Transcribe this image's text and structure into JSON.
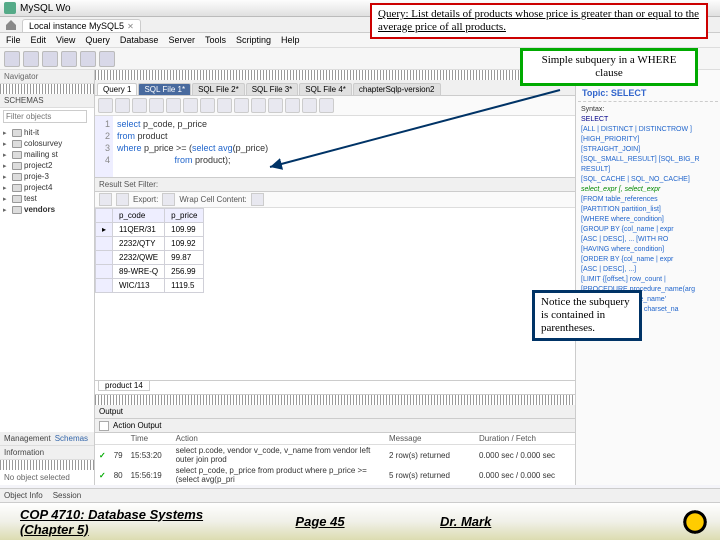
{
  "window": {
    "title": "MySQL Wo"
  },
  "conn_tab": {
    "label": "Local instance MySQL5"
  },
  "menubar": [
    "File",
    "Edit",
    "View",
    "Query",
    "Database",
    "Server",
    "Tools",
    "Scripting",
    "Help"
  ],
  "nav": {
    "header": "Navigator",
    "schemas_label": "SCHEMAS",
    "filter_placeholder": "Filter objects",
    "items": [
      {
        "label": "hit-it",
        "bold": false
      },
      {
        "label": "colosurvey",
        "bold": false
      },
      {
        "label": "mailing st",
        "bold": false
      },
      {
        "label": "project2",
        "bold": false
      },
      {
        "label": "proje-3",
        "bold": false
      },
      {
        "label": "project4",
        "bold": false
      },
      {
        "label": "test",
        "bold": false
      },
      {
        "label": "vendors",
        "bold": true
      }
    ],
    "mgmt_label": "Management",
    "mgmt_tab": "Schemas",
    "info_label": "Information",
    "info_text": "No object selected"
  },
  "query_tabs": [
    {
      "label": "Query 1",
      "kind": "sel"
    },
    {
      "label": "SQL File 1*",
      "kind": "active"
    },
    {
      "label": "SQL File 2*",
      "kind": "plain"
    },
    {
      "label": "SQL File 3*",
      "kind": "plain"
    },
    {
      "label": "SQL File 4*",
      "kind": "plain"
    },
    {
      "label": "chapterSqlp-version2",
      "kind": "plain"
    }
  ],
  "editor": {
    "lines": [
      "1",
      "2",
      "3",
      "4"
    ],
    "code": {
      "l1": {
        "kw": "select",
        "rest": " p_code, p_price"
      },
      "l2": {
        "kw": "from",
        "id": " product"
      },
      "l3": {
        "kw": "where",
        "mid": " p_price >= (",
        "fn": "select avg",
        "paren": "(p_price)"
      },
      "l4": {
        "kw": "                       from",
        "id": " product);"
      }
    }
  },
  "result": {
    "bar": "Result Set Filter:",
    "export": "Export:",
    "wrap": "Wrap Cell Content:",
    "cols": [
      "p_code",
      "p_price"
    ],
    "rows": [
      [
        "11QER/31",
        "109.99"
      ],
      [
        "2232/QTY",
        "109.92"
      ],
      [
        "2232/QWE",
        "99.87"
      ],
      [
        "89-WRE-Q",
        "256.99"
      ],
      [
        "WIC/113",
        "1119.5"
      ]
    ],
    "tab": "product 14"
  },
  "output": {
    "label": "Output",
    "type": "Action Output",
    "cols": [
      "",
      "",
      "Time",
      "Action",
      "Message",
      "Duration / Fetch"
    ],
    "rows": [
      {
        "ok": "✓",
        "n": "79",
        "t": "15:53:20",
        "a": "select p.code, vendor v_code, v_name from vendor left outer join prod",
        "m": "2 row(s) returned",
        "d": "0.000 sec / 0.000 sec"
      },
      {
        "ok": "✓",
        "n": "80",
        "t": "15:56:19",
        "a": "select p_code, p_price from product where p_price >= (select avg(p_pri",
        "m": "5 row(s) returned",
        "d": "0.000 sec / 0.000 sec"
      }
    ]
  },
  "statusbar": {
    "l": "Object Info",
    "r": "Session"
  },
  "help": {
    "pill": "SELECT",
    "topic_label": "Topic:",
    "topic": "SELECT",
    "syntax_label": "Syntax:",
    "kw": "SELECT",
    "lines": [
      "[ALL | DISTINCT | DISTINCTROW ]",
      "  [HIGH_PRIORITY]",
      "  [STRAIGHT_JOIN]",
      "  [SQL_SMALL_RESULT] [SQL_BIG_R",
      "RESULT]",
      "  [SQL_CACHE | SQL_NO_CACHE]",
      "select_expr [, select_expr",
      "[FROM table_references",
      "  [PARTITION partition_list]",
      "[WHERE where_condition]",
      "[GROUP BY {col_name | expr",
      "  [ASC | DESC], ... [WITH RO",
      "[HAVING where_condition]",
      "[ORDER BY {col_name | expr",
      "  [ASC | DESC], ...]",
      "[LIMIT {[offset,] row_count |",
      "[PROCEDURE procedure_name(arg",
      "[INTO OUTFILE 'file_name'",
      "    [CHARACTER SET charset_na"
    ]
  },
  "overlays": {
    "query": "Query:  List details of products whose price is greater than or equal to the average price of all products.",
    "subquery": "Simple subquery in a WHERE clause",
    "notice": "Notice the subquery is contained in parentheses."
  },
  "footer": {
    "left": "COP 4710: Database Systems  (Chapter 5)",
    "center": "Page 45",
    "right": "Dr. Mark"
  }
}
